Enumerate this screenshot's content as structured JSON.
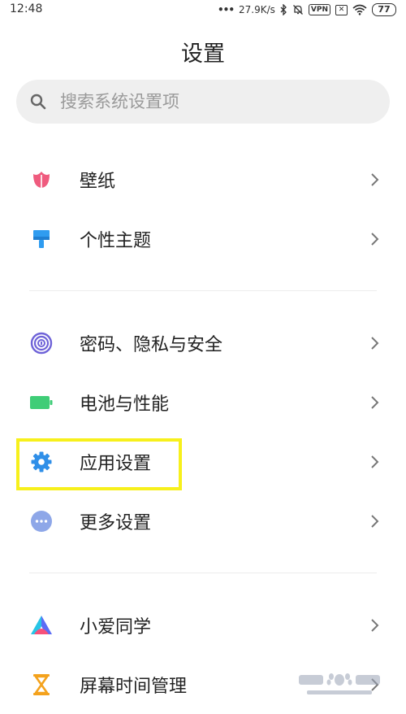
{
  "status_bar": {
    "time": "12:48",
    "net_speed": "27.9K/s",
    "vpn_label": "VPN",
    "battery_level": "77"
  },
  "header": {
    "title": "设置"
  },
  "search": {
    "placeholder": "搜索系统设置项"
  },
  "groups": [
    {
      "items": [
        {
          "label": "壁纸",
          "icon": "tulip-wallpaper-icon",
          "color": "#ef5b7e"
        },
        {
          "label": "个性主题",
          "icon": "paintbrush-theme-icon",
          "color": "#2f9cf0"
        }
      ]
    },
    {
      "items": [
        {
          "label": "密码、隐私与安全",
          "icon": "fingerprint-icon",
          "color": "#6f63d8"
        },
        {
          "label": "电池与性能",
          "icon": "battery-icon",
          "color": "#3fcd77"
        },
        {
          "label": "应用设置",
          "icon": "gear-icon",
          "color": "#2f8fe8"
        },
        {
          "label": "更多设置",
          "icon": "more-dots-icon",
          "color": "#8ea7e8"
        }
      ]
    },
    {
      "items": [
        {
          "label": "小爱同学",
          "icon": "xiaoai-assistant-icon",
          "color": "#5b6cf5"
        },
        {
          "label": "屏幕时间管理",
          "icon": "hourglass-icon",
          "color": "#f4a21c"
        }
      ]
    }
  ],
  "highlight": {
    "color": "#f7f01c"
  }
}
